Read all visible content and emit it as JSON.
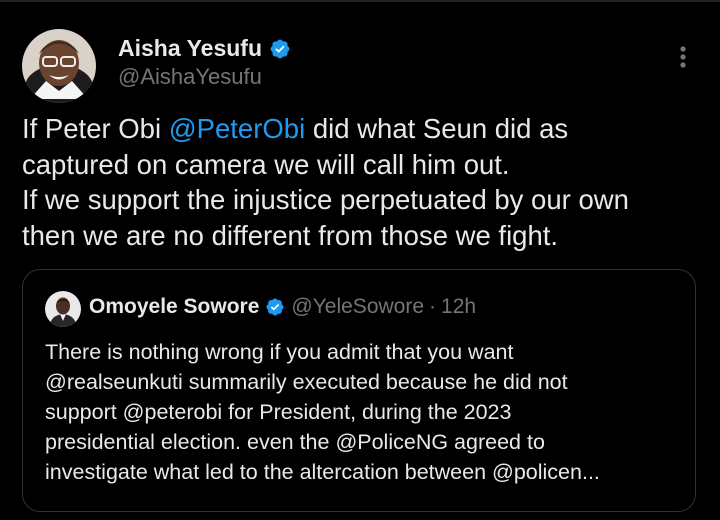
{
  "colors": {
    "background": "#000000",
    "text": "#e7e9ea",
    "secondary": "#71767b",
    "link": "#1d9bf0",
    "verified": "#1d9bf0",
    "border": "#2f3336"
  },
  "tweet": {
    "author": {
      "name": "Aisha Yesufu",
      "handle": "@AishaYesufu",
      "verified": true,
      "avatar_icon": "avatar-photo"
    },
    "menu_icon": "more-vertical-icon",
    "text_lines": [
      {
        "before": "If Peter Obi ",
        "mention": "@PeterObi",
        "after": " did what Seun did as"
      },
      {
        "text": "captured on camera we will call him out."
      },
      {
        "text": "If we support the injustice perpetuated by our own"
      },
      {
        "text": "then we are no different from those we fight."
      }
    ]
  },
  "quote": {
    "author": {
      "name": "Omoyele Sowore",
      "handle": "@YeleSowore",
      "separator": "·",
      "time": "12h",
      "verified": true,
      "avatar_icon": "avatar-photo"
    },
    "text_lines": [
      "There is nothing wrong if you admit that you want",
      "@realseunkuti summarily executed because he did not",
      "support @peterobi for President, during the 2023",
      "presidential election. even the @PoliceNG agreed to",
      "investigate what led to the altercation between @policen..."
    ]
  }
}
